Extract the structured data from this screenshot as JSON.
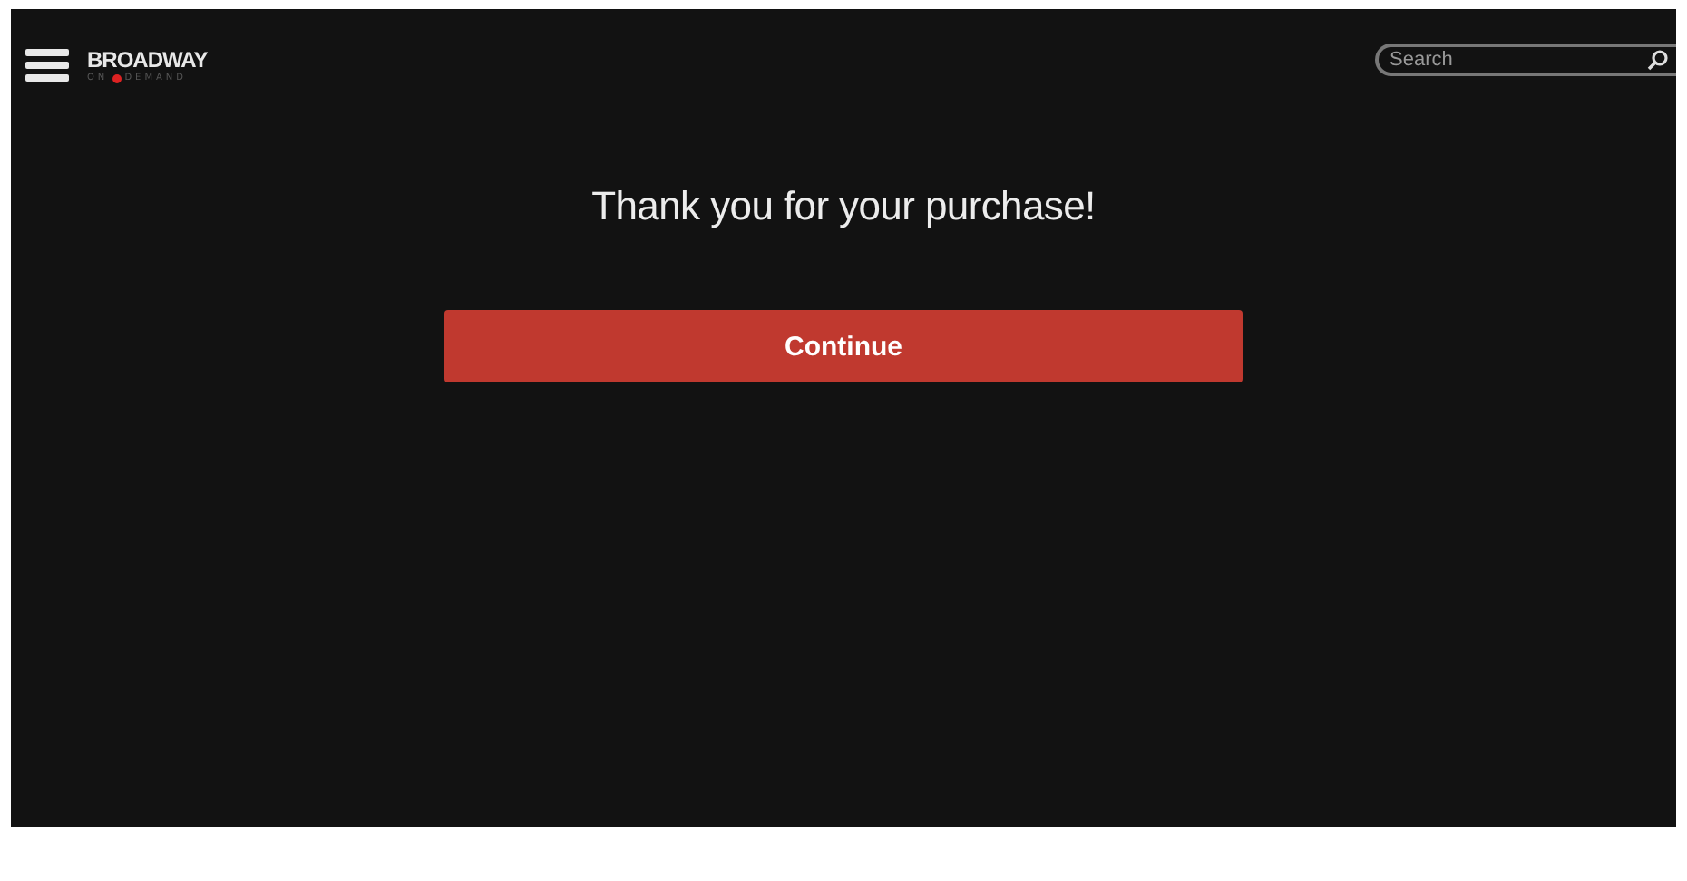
{
  "header": {
    "logo": {
      "title": "BROADWAY",
      "sub_left": "ON",
      "sub_right": "DEMAND"
    },
    "search": {
      "placeholder": "Search"
    }
  },
  "message": "Thank you for your purchase!",
  "button": "Continue"
}
